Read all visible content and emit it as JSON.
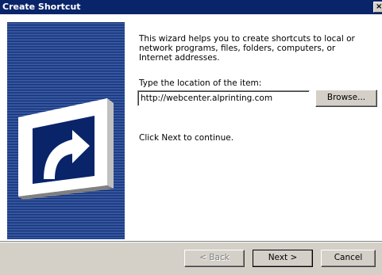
{
  "window": {
    "title": "Create Shortcut",
    "close_glyph": "×"
  },
  "banner": {
    "icon": "shortcut-arrow-icon"
  },
  "main": {
    "intro_text": "This wizard helps you to create shortcuts to local or network programs, files, folders, computers, or Internet addresses.",
    "location_label": "Type the location of the item:",
    "location_value": "http://webcenter.alprinting.com",
    "browse_label": "Browse...",
    "continue_text": "Click Next to continue."
  },
  "footer": {
    "back_label": "< Back",
    "next_label": "Next >",
    "cancel_label": "Cancel"
  },
  "colors": {
    "titlebar": "#0a246a",
    "banner": "#0a246a",
    "face": "#d4d0c8"
  }
}
